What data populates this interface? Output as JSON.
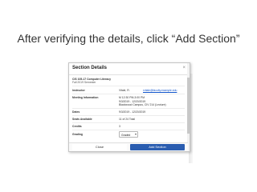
{
  "slide": {
    "title": "After verifying the details, click “Add Section”"
  },
  "dialog": {
    "title": "Section Details",
    "close_icon": "×",
    "course_code": "CIS 105-17 Computer Literacy",
    "term": "Fall 2019 Semester",
    "fields": {
      "instructor_label": "Instructor",
      "instructor_value": "Vitale, R.",
      "instructor_email": "rvitale@faculty.example.edu",
      "meeting_label": "Meeting Information",
      "meeting_time": "M 12:30 PM-3:00 PM",
      "meeting_dates": "9/3/2019 - 12/20/2019",
      "meeting_location": "Blackwood Campus, CIV 214 (Lecture)",
      "dates_label": "Dates",
      "dates_value": "9/3/2019 - 12/20/2019",
      "seats_label": "Seats Available",
      "seats_value": "11 of 24 Total",
      "credits_label": "Credits",
      "credits_value": "3",
      "grading_label": "Grading",
      "grading_value": "Graded"
    },
    "buttons": {
      "close": "Close",
      "add_section": "Add Section"
    }
  },
  "colors": {
    "primary_button": "#2a5db0",
    "link": "#1155cc"
  },
  "icons": {
    "close": "close-icon",
    "dropdown": "chevron-down-icon"
  }
}
